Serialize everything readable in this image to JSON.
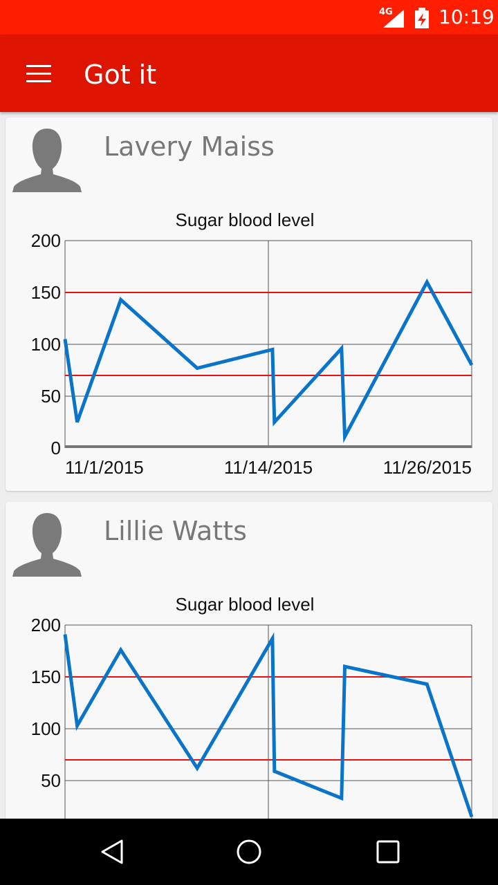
{
  "status_bar": {
    "network": "4G",
    "time": "10:19",
    "icons": [
      "signal-icon",
      "battery-charging-icon"
    ]
  },
  "app_bar": {
    "title": "Got it",
    "menu_icon": "menu-icon"
  },
  "colors": {
    "status_bar": "#ff1f00",
    "app_bar": "#dd1400",
    "line": "#0a74c8",
    "threshold": "#e81010"
  },
  "patients": [
    {
      "name": "Lavery Maiss",
      "avatar_icon": "person-silhouette-icon"
    },
    {
      "name": "Lillie Watts",
      "avatar_icon": "person-silhouette-icon"
    }
  ],
  "chart_data": [
    {
      "type": "line",
      "title": "Sugar blood level",
      "ylim": [
        0,
        200
      ],
      "yticks": [
        0,
        50,
        100,
        150,
        200
      ],
      "x_tick_labels": [
        "11/1/2015",
        "11/14/2015",
        "11/26/2015"
      ],
      "thresholds": [
        150,
        70
      ],
      "grid": true,
      "series": [
        {
          "values": [
            105,
            25,
            143,
            77,
            95,
            25,
            96,
            11,
            160,
            80
          ]
        }
      ]
    },
    {
      "type": "line",
      "title": "Sugar blood level",
      "ylim": [
        0,
        200
      ],
      "yticks": [
        50,
        100,
        150,
        200
      ],
      "x_tick_labels": [],
      "thresholds": [
        150,
        70
      ],
      "grid": true,
      "series": [
        {
          "values": [
            191,
            103,
            176,
            62,
            187,
            59,
            33,
            160,
            143,
            15
          ]
        }
      ]
    }
  ],
  "nav_bar": {
    "icons": [
      "back-icon",
      "home-icon",
      "recents-icon"
    ]
  }
}
